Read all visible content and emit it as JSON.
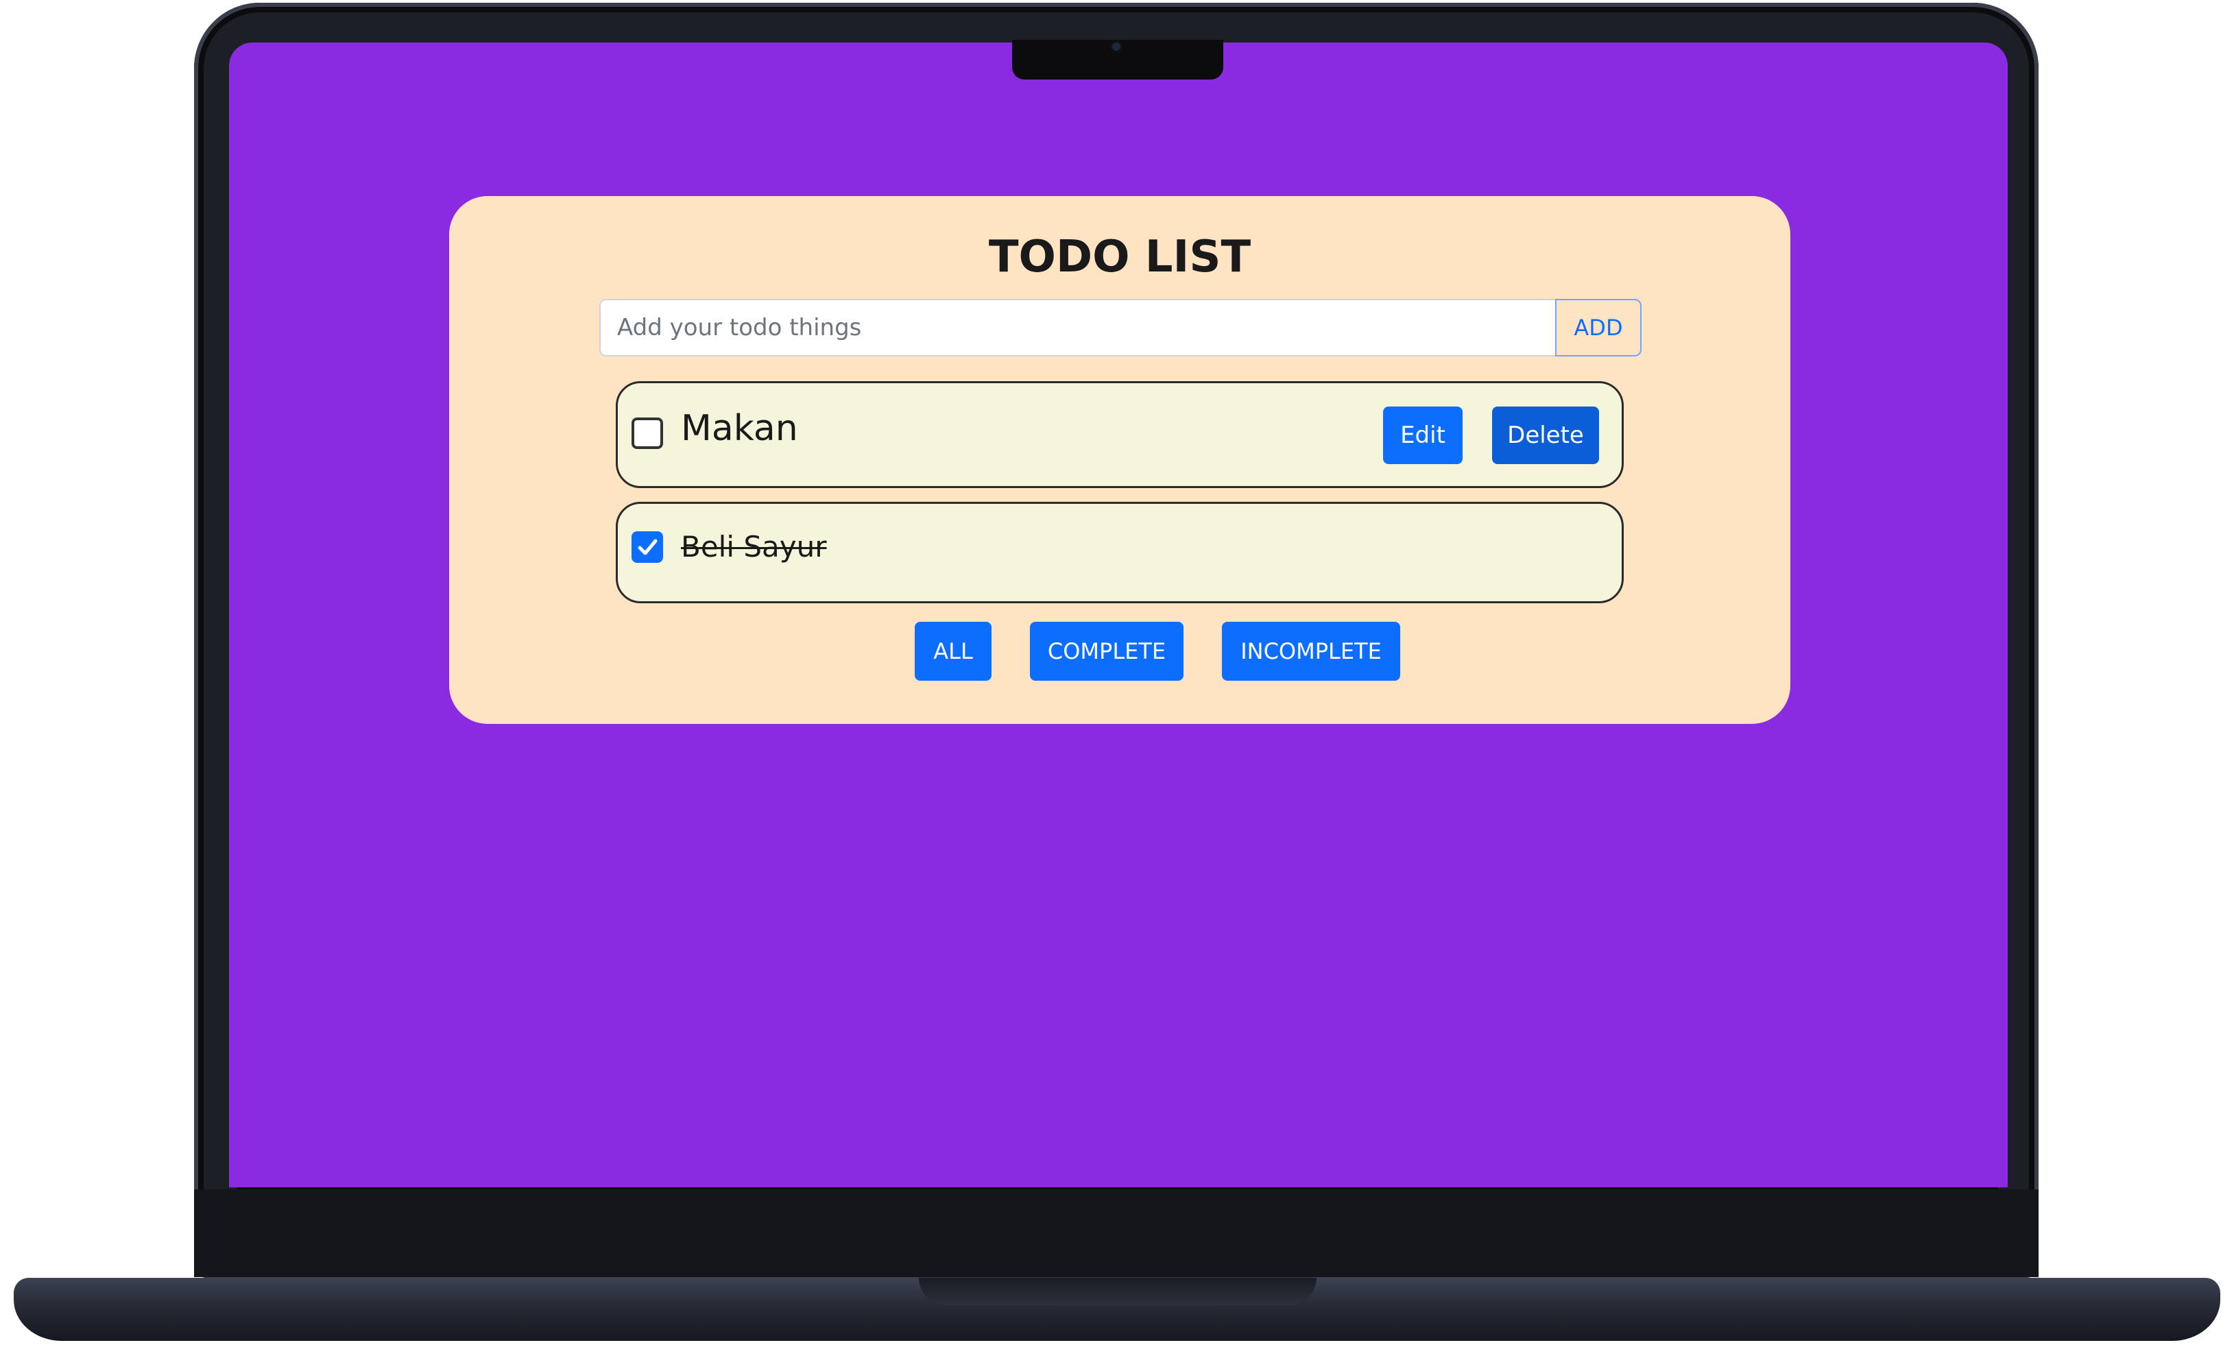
{
  "app": {
    "title": "TODO LIST"
  },
  "input": {
    "placeholder": "Add your todo things",
    "value": "",
    "add_label": "ADD"
  },
  "todos": [
    {
      "text": "Makan",
      "completed": false,
      "edit_label": "Edit",
      "delete_label": "Delete"
    },
    {
      "text": "Beli Sayur",
      "completed": true
    }
  ],
  "filters": [
    {
      "label": "ALL"
    },
    {
      "label": "COMPLETE"
    },
    {
      "label": "INCOMPLETE"
    }
  ],
  "colors": {
    "screen_background": "#8a2be2",
    "card_background": "#ffe4c4",
    "item_background": "#f5f5dc",
    "primary": "#0d6efd"
  }
}
